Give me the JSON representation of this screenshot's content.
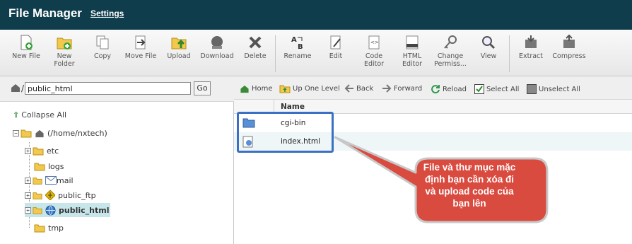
{
  "header": {
    "title": "File Manager",
    "settings": "Settings"
  },
  "toolbar": {
    "buttons": [
      {
        "label1": "New File",
        "label2": ""
      },
      {
        "label1": "New",
        "label2": "Folder"
      },
      {
        "label1": "Copy",
        "label2": ""
      },
      {
        "label1": "Move File",
        "label2": ""
      },
      {
        "label1": "Upload",
        "label2": ""
      },
      {
        "label1": "Download",
        "label2": ""
      },
      {
        "label1": "Delete",
        "label2": ""
      },
      {
        "label1": "Rename",
        "label2": ""
      },
      {
        "label1": "Edit",
        "label2": ""
      },
      {
        "label1": "Code",
        "label2": "Editor"
      },
      {
        "label1": "HTML",
        "label2": "Editor"
      },
      {
        "label1": "Change",
        "label2": "Permiss..."
      },
      {
        "label1": "View",
        "label2": ""
      },
      {
        "label1": "Extract",
        "label2": ""
      },
      {
        "label1": "Compress",
        "label2": ""
      }
    ]
  },
  "left": {
    "path_value": "public_html",
    "go_label": "Go",
    "collapse_label": "Collapse All",
    "root_label": "(/home/nxtech)",
    "folders": [
      "etc",
      "logs",
      "mail",
      "public_ftp",
      "public_html",
      "tmp"
    ]
  },
  "nav": {
    "home": "Home",
    "up": "Up One Level",
    "back": "Back",
    "forward": "Forward",
    "reload": "Reload",
    "select_all": "Select All",
    "unselect_all": "Unselect All"
  },
  "table": {
    "name_header": "Name",
    "rows": [
      {
        "name": "cgi-bin",
        "type": "folder"
      },
      {
        "name": "index.html",
        "type": "html"
      }
    ]
  },
  "callout": {
    "line1": "File và thư mục mặc",
    "line2": "định bạn cần xóa đi",
    "line3": "và upload code của",
    "line4": "bạn lên"
  },
  "colors": {
    "header_bg": "#0f3d4c",
    "highlight_border": "#3a6fc4",
    "callout_fill": "#d94a3f",
    "selected_bg": "#c7e6ea"
  }
}
